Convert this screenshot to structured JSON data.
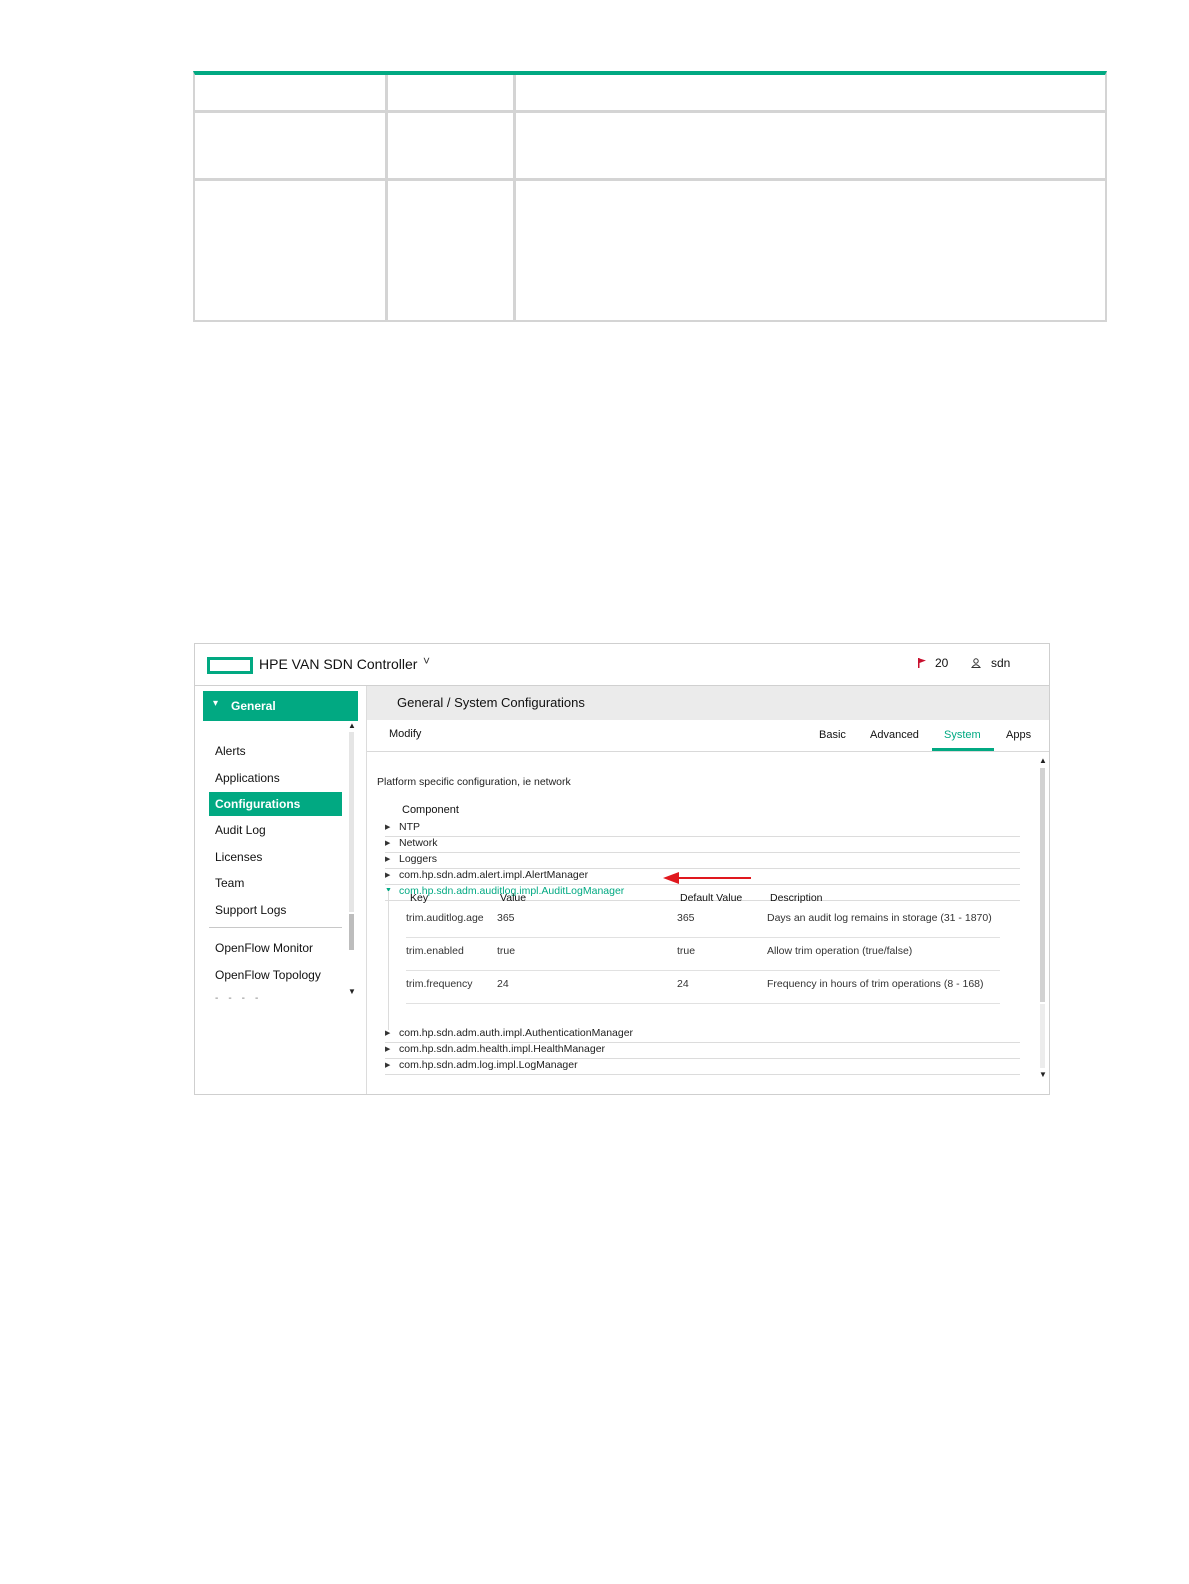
{
  "app": {
    "title": "HPE VAN SDN Controller",
    "title_chevron": "˅",
    "alert_count": "20",
    "user": "sdn"
  },
  "sidebar": {
    "header": "General",
    "items": [
      {
        "label": "Alerts"
      },
      {
        "label": "Applications"
      },
      {
        "label": "Configurations",
        "active": true
      },
      {
        "label": "Audit Log"
      },
      {
        "label": "Licenses"
      },
      {
        "label": "Team"
      },
      {
        "label": "Support Logs"
      }
    ],
    "items2": [
      {
        "label": "OpenFlow Monitor"
      },
      {
        "label": "OpenFlow Topology"
      }
    ]
  },
  "main": {
    "breadcrumb": "General / System Configurations",
    "modify_label": "Modify",
    "tabs": [
      {
        "label": "Basic"
      },
      {
        "label": "Advanced"
      },
      {
        "label": "System",
        "active": true
      },
      {
        "label": "Apps"
      }
    ],
    "description": "Platform specific configuration, ie network",
    "component_header": "Component",
    "components_top": [
      {
        "name": "NTP"
      },
      {
        "name": "Network"
      },
      {
        "name": "Loggers"
      },
      {
        "name": "com.hp.sdn.adm.alert.impl.AlertManager"
      }
    ],
    "expanded_component": "com.hp.sdn.adm.auditlog.impl.AuditLogManager",
    "config_table": {
      "headers": [
        "Key",
        "Value",
        "Default Value",
        "Description"
      ],
      "rows": [
        [
          "trim.auditlog.age",
          "365",
          "365",
          "Days an audit log remains in storage (31 - 1870)"
        ],
        [
          "trim.enabled",
          "true",
          "true",
          "Allow trim operation (true/false)"
        ],
        [
          "trim.frequency",
          "24",
          "24",
          "Frequency in hours of trim operations (8 - 168)"
        ]
      ]
    },
    "components_bottom": [
      {
        "name": "com.hp.sdn.adm.auth.impl.AuthenticationManager"
      },
      {
        "name": "com.hp.sdn.adm.health.impl.HealthManager"
      },
      {
        "name": "com.hp.sdn.adm.log.impl.LogManager"
      }
    ]
  },
  "colors": {
    "accent": "#01a982",
    "annotation_arrow": "#e0181e"
  }
}
